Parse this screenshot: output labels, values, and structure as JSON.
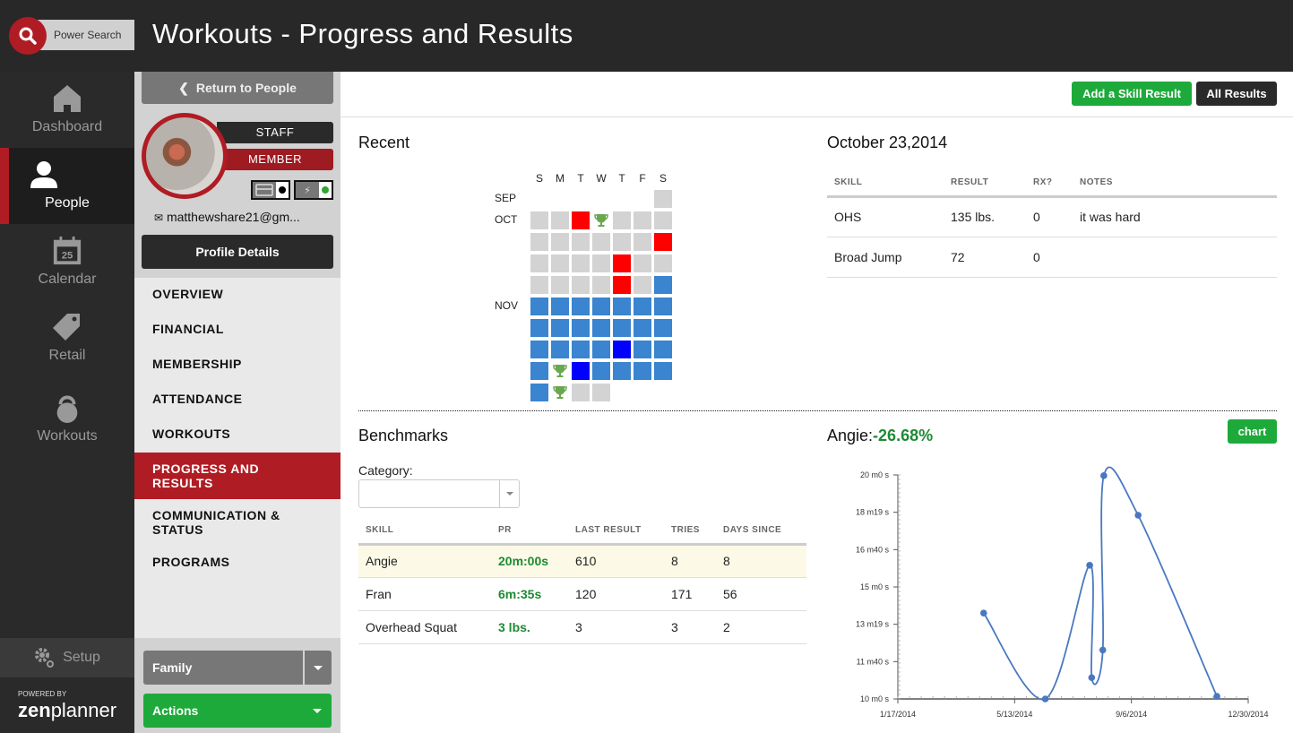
{
  "header": {
    "search_label": "Power Search",
    "title": "Workouts - Progress and Results"
  },
  "leftnav": {
    "items": [
      {
        "label": "Dashboard",
        "icon": "home-icon",
        "active": false
      },
      {
        "label": "People",
        "icon": "person-icon",
        "active": true
      },
      {
        "label": "Calendar",
        "icon": "calendar-icon",
        "calendar_day": "25",
        "active": false
      },
      {
        "label": "Retail",
        "icon": "tag-icon",
        "active": false
      },
      {
        "label": "Workouts",
        "icon": "kettlebell-icon",
        "active": false
      }
    ],
    "setup_label": "Setup",
    "powered_by": "POWERED BY",
    "brand_bold": "zen",
    "brand_light": "planner"
  },
  "profile": {
    "return_label": "Return to People",
    "badges": {
      "staff": "STAFF",
      "member": "MEMBER"
    },
    "email": "matthewshare21@gm...",
    "profile_details_label": "Profile Details",
    "status_icons": [
      {
        "icon": "credit-card-icon",
        "dot_color": "#000000"
      },
      {
        "icon": "lightning-icon",
        "dot_color": "#2fa82f"
      }
    ],
    "menu": [
      {
        "label": "OVERVIEW",
        "active": false
      },
      {
        "label": "FINANCIAL",
        "active": false
      },
      {
        "label": "MEMBERSHIP",
        "active": false
      },
      {
        "label": "ATTENDANCE",
        "active": false
      },
      {
        "label": "WORKOUTS",
        "active": false
      },
      {
        "label": "PROGRESS AND RESULTS",
        "active": true
      },
      {
        "label": "COMMUNICATION & STATUS",
        "active": false
      },
      {
        "label": "PROGRAMS",
        "active": false
      }
    ],
    "family_label": "Family",
    "actions_label": "Actions"
  },
  "toolbar": {
    "add_skill_label": "Add a Skill Result",
    "all_results_label": "All Results"
  },
  "recent": {
    "title": "Recent",
    "day_headers": [
      "S",
      "M",
      "T",
      "W",
      "T",
      "F",
      "S"
    ],
    "months": [
      {
        "label": "SEP",
        "row": 0
      },
      {
        "label": "OCT",
        "row": 1
      },
      {
        "label": "NOV",
        "row": 5
      }
    ],
    "rows": [
      [
        null,
        null,
        null,
        null,
        null,
        null,
        "gray"
      ],
      [
        "gray",
        "gray",
        "red",
        "trophy",
        "gray",
        "gray",
        "gray"
      ],
      [
        "gray",
        "gray",
        "gray",
        "gray",
        "gray",
        "gray",
        "red"
      ],
      [
        "gray",
        "gray",
        "gray",
        "gray",
        "red",
        "gray",
        "gray"
      ],
      [
        "gray",
        "gray",
        "gray",
        "gray",
        "red",
        "gray",
        "blue"
      ],
      [
        "blue",
        "blue",
        "blue",
        "blue",
        "blue",
        "blue",
        "blue"
      ],
      [
        "blue",
        "blue",
        "blue",
        "blue",
        "blue",
        "blue",
        "blue"
      ],
      [
        "blue",
        "blue",
        "blue",
        "blue",
        "dblue",
        "blue",
        "blue"
      ],
      [
        "blue",
        "trophy",
        "dblue",
        "blue",
        "blue",
        "blue",
        "blue"
      ],
      [
        "blue",
        "trophy",
        "gray",
        "gray",
        null,
        null,
        null
      ]
    ]
  },
  "day_results": {
    "title": "October 23,2014",
    "columns": [
      "SKILL",
      "RESULT",
      "RX?",
      "NOTES"
    ],
    "rows": [
      [
        "OHS",
        "135 lbs.",
        "0",
        "it was hard"
      ],
      [
        "Broad Jump",
        "72",
        "0",
        ""
      ]
    ]
  },
  "benchmarks": {
    "title": "Benchmarks",
    "category_label": "Category:",
    "category_value": "",
    "columns": [
      "SKILL",
      "PR",
      "LAST RESULT",
      "TRIES",
      "DAYS SINCE"
    ],
    "rows": [
      {
        "skill": "Angie",
        "pr": "20m:00s",
        "last": "610",
        "tries": "8",
        "days": "8",
        "highlighted": true
      },
      {
        "skill": "Fran",
        "pr": "6m:35s",
        "last": "120",
        "tries": "171",
        "days": "56",
        "highlighted": false
      },
      {
        "skill": "Overhead Squat",
        "pr": "3 lbs.",
        "last": "3",
        "tries": "3",
        "days": "2",
        "highlighted": false
      }
    ]
  },
  "angie": {
    "name": "Angie:",
    "change": "-26.68%",
    "chart_button": "chart"
  },
  "chart_data": {
    "type": "line",
    "title": "Angie:-26.68%",
    "xlabel": "",
    "ylabel": "",
    "x_ticks": [
      "1/17/2014",
      "5/13/2014",
      "9/6/2014",
      "12/30/2014"
    ],
    "x_range_days": [
      0,
      347
    ],
    "y_ticks": [
      "10 m0 s",
      "11 m40 s",
      "13 m19 s",
      "15 m0 s",
      "16 m40 s",
      "18 m19 s",
      "20 m0 s"
    ],
    "y_range_seconds": [
      600,
      1200
    ],
    "grid": false,
    "series": [
      {
        "name": "Angie",
        "color": "#4a78c0",
        "points": [
          {
            "date": "4/12/2014",
            "day": 85,
            "seconds": 830
          },
          {
            "date": "6/12/2014",
            "day": 146,
            "seconds": 600
          },
          {
            "date": "7/26/2014",
            "day": 190,
            "seconds": 958
          },
          {
            "date": "7/28/2014",
            "day": 192,
            "seconds": 657
          },
          {
            "date": "8/8/2014",
            "day": 203,
            "seconds": 731
          },
          {
            "date": "8/9/2014",
            "day": 204,
            "seconds": 1198
          },
          {
            "date": "9/12/2014",
            "day": 238,
            "seconds": 1092
          },
          {
            "date": "11/29/2014",
            "day": 316,
            "seconds": 607
          }
        ]
      }
    ]
  }
}
